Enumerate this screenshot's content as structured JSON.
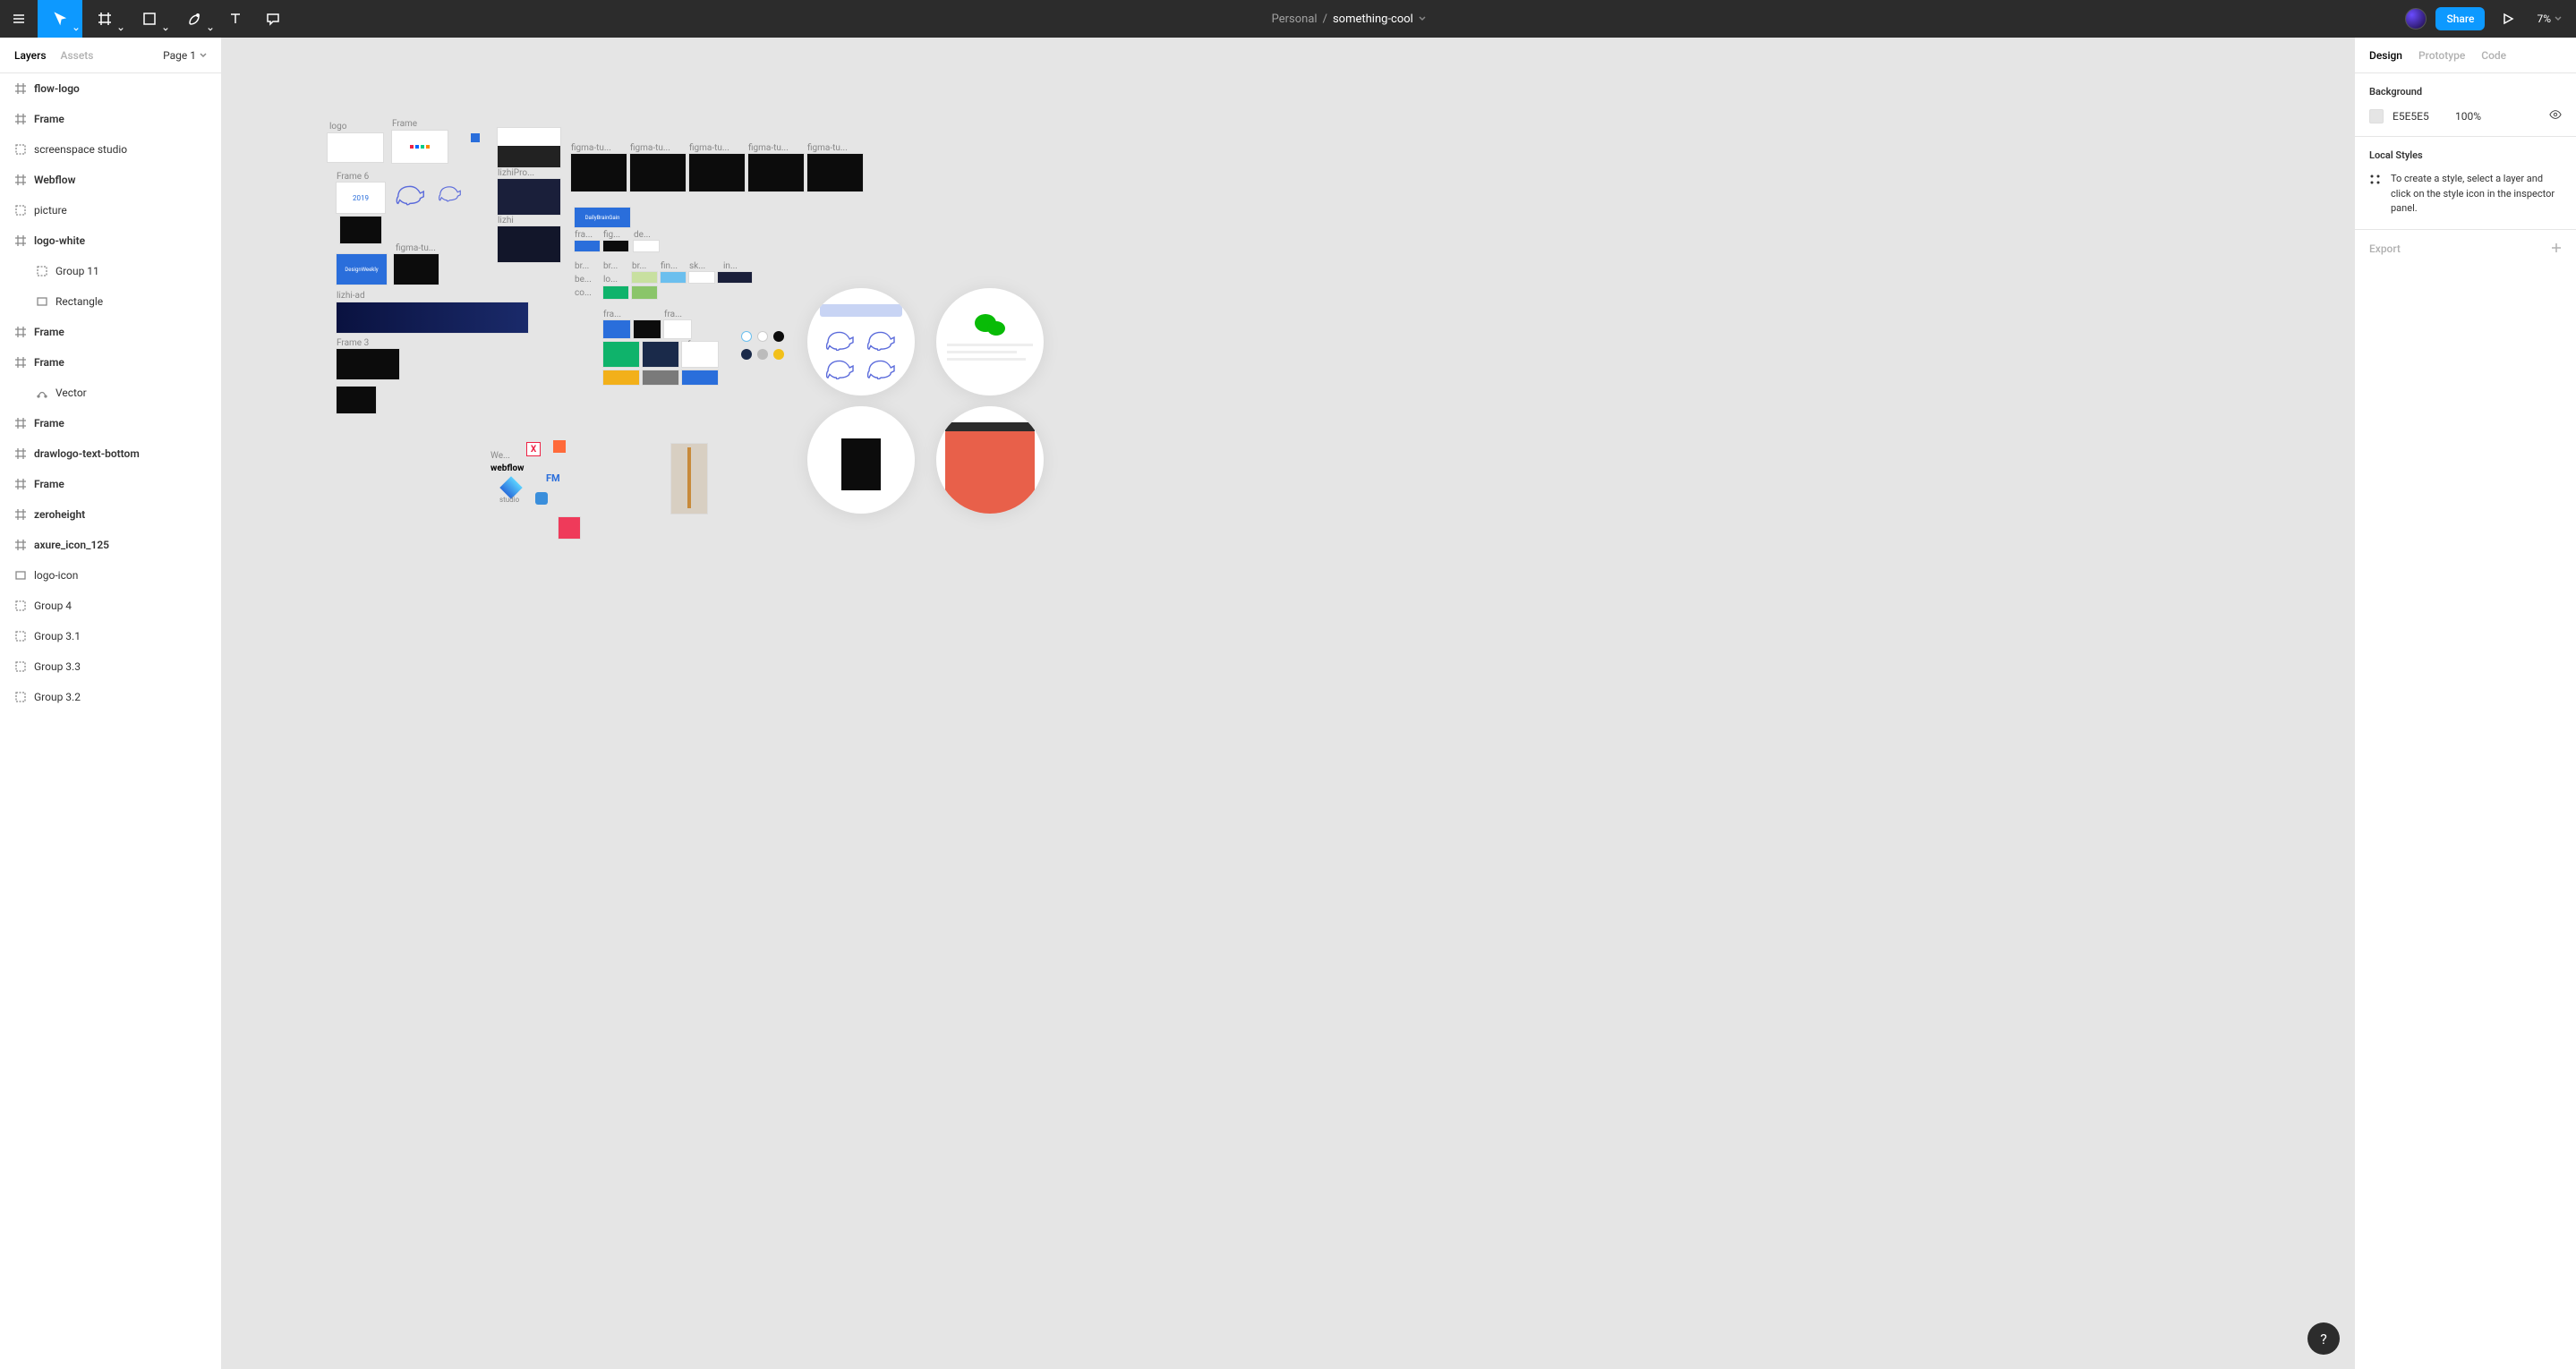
{
  "toolbar": {
    "project_label": "Personal",
    "separator": "/",
    "file_name": "something-cool",
    "share_label": "Share",
    "zoom": "7%"
  },
  "left_panel": {
    "tabs": {
      "layers": "Layers",
      "assets": "Assets"
    },
    "page_label": "Page 1",
    "layers": [
      {
        "name": "flow-logo",
        "icon": "frame",
        "bold": true
      },
      {
        "name": "Frame",
        "icon": "frame",
        "bold": true
      },
      {
        "name": "screenspace studio",
        "icon": "group"
      },
      {
        "name": "Webflow",
        "icon": "frame",
        "bold": true
      },
      {
        "name": "picture",
        "icon": "group"
      },
      {
        "name": "logo-white",
        "icon": "frame",
        "bold": true
      },
      {
        "name": "Group 11",
        "icon": "group",
        "indent": 1
      },
      {
        "name": "Rectangle",
        "icon": "rect",
        "indent": 1
      },
      {
        "name": "Frame",
        "icon": "frame",
        "bold": true
      },
      {
        "name": "Frame",
        "icon": "frame",
        "bold": true
      },
      {
        "name": "Vector",
        "icon": "vector",
        "indent": 1
      },
      {
        "name": "Frame",
        "icon": "frame",
        "bold": true
      },
      {
        "name": "drawlogo-text-bottom",
        "icon": "frame",
        "bold": true
      },
      {
        "name": "Frame",
        "icon": "frame",
        "bold": true
      },
      {
        "name": "zeroheight",
        "icon": "frame",
        "bold": true
      },
      {
        "name": "axure_icon_125",
        "icon": "frame",
        "bold": true
      },
      {
        "name": "logo-icon",
        "icon": "rect"
      },
      {
        "name": "Group 4",
        "icon": "group"
      },
      {
        "name": "Group 3.1",
        "icon": "group"
      },
      {
        "name": "Group 3.3",
        "icon": "group"
      },
      {
        "name": "Group 3.2",
        "icon": "group"
      }
    ]
  },
  "right_panel": {
    "tabs": {
      "design": "Design",
      "prototype": "Prototype",
      "code": "Code"
    },
    "background": {
      "title": "Background",
      "hex": "E5E5E5",
      "opacity": "100%"
    },
    "local_styles": {
      "title": "Local Styles",
      "help": "To create a style, select a layer and click on the style icon in the inspector panel."
    },
    "export_label": "Export"
  },
  "canvas": {
    "labels": {
      "logo": "logo",
      "frame": "Frame",
      "frame6": "Frame 6",
      "figma_tu": "figma-tu...",
      "lizhi_ad": "lizhi-ad",
      "frame3": "Frame 3",
      "lizhi_pro": "lizhiPro...",
      "lizhi": "lizhi",
      "we": "We...",
      "fra": "fra...",
      "fig": "fig...",
      "de": "de...",
      "br": "br...",
      "be": "be...",
      "lo": "lo...",
      "co": "co...",
      "fin": "fin...",
      "sk": "sk...",
      "in": "in...",
      "webflow": "webflow",
      "studio": "studio",
      "fm": "FM",
      "daily": "DailyBrainGain",
      "design_weekly": "DesignWeekly",
      "y2019": "2019"
    }
  }
}
